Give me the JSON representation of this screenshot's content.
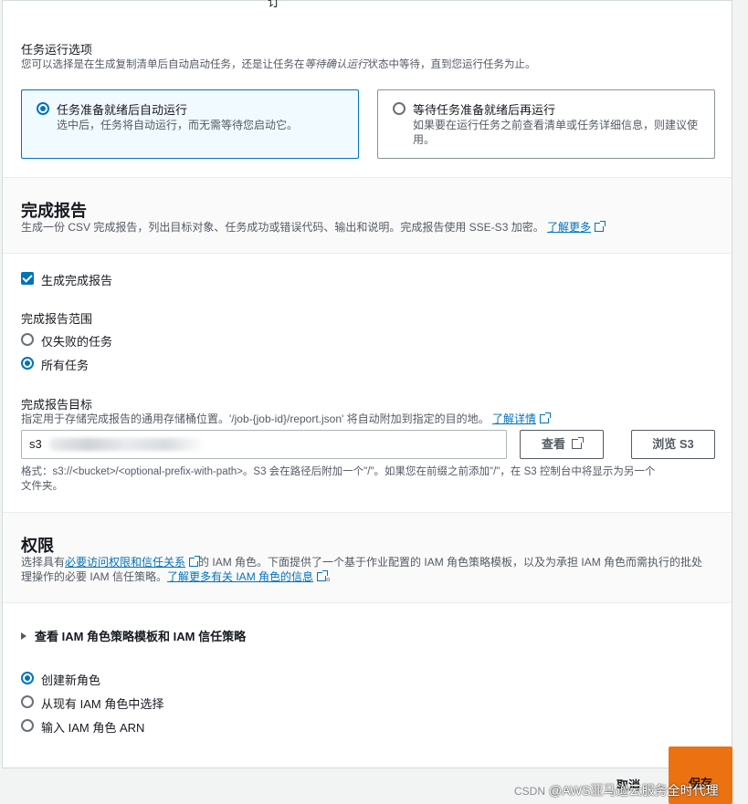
{
  "top_partial_text": "订 ",
  "run_options": {
    "title": "任务运行选项",
    "desc_prefix": "您可以选择是在生成复制清单后自动启动任务，还是让任务在",
    "desc_italic": "等待确认运行",
    "desc_suffix": "状态中等待，直到您运行任务为止。",
    "options": [
      {
        "title": "任务准备就绪后自动运行",
        "desc": "选中后，任务将自动运行，而无需等待您启动它。",
        "selected": true
      },
      {
        "title": "等待任务准备就绪后再运行",
        "desc_line1": "如果要在运行任务之前查看清单或任务详细信息，则建议使",
        "desc_line2": "用。",
        "selected": false
      }
    ]
  },
  "completion_report": {
    "title": "完成报告",
    "desc": "生成一份 CSV 完成报告，列出目标对象、任务成功或错误代码、输出和说明。完成报告使用 SSE-S3 加密。",
    "learn_more": "了解更多",
    "checkbox_label": "生成完成报告",
    "scope_label": "完成报告范围",
    "scope_options": [
      {
        "label": "仅失败的任务",
        "selected": false
      },
      {
        "label": "所有任务",
        "selected": true
      }
    ],
    "destination_label": "完成报告目标",
    "destination_desc": "指定用于存储完成报告的通用存储桶位置。'/job-{job-id}/report.json' 将自动附加到指定的目的地。",
    "destination_link": "了解详情",
    "input_value": "s3",
    "view_button": "查看",
    "browse_button": "浏览 S3",
    "format_line1": "格式：s3://<bucket>/<optional-prefix-with-path>。S3 会在路径后附加一个\"/\"。如果您在前缀之前添加\"/\"，在 S3 控制台中将显示为另一个",
    "format_line2": "文件夹。"
  },
  "permissions": {
    "title": "权限",
    "desc_prefix": "选择具有",
    "desc_link": "必要访问权限和信任关系",
    "desc_mid": "的 IAM 角色。下面提供了一个基于作业配置的 IAM 角色策略模板，以及为承担 IAM 角色而需执行的批处",
    "desc_line2_prefix": "理操作的必要 IAM 信任策略。",
    "desc_link2": "了解更多有关 IAM 角色的信息",
    "desc_end": "。",
    "expander": "查看 IAM 角色策略模板和 IAM 信任策略",
    "role_options": [
      {
        "label": "创建新角色",
        "selected": true
      },
      {
        "label": "从现有 IAM 角色中选择",
        "selected": false
      },
      {
        "label": "输入 IAM 角色 ARN",
        "selected": false
      }
    ]
  },
  "footer": {
    "cancel": "取消",
    "save": "保存"
  },
  "watermark": {
    "csdn": "CSDN",
    "text": "@AWS亚马逊云服务全时代理"
  },
  "colors": {
    "accent": "#0073bb",
    "primary_button": "#ec7211"
  }
}
